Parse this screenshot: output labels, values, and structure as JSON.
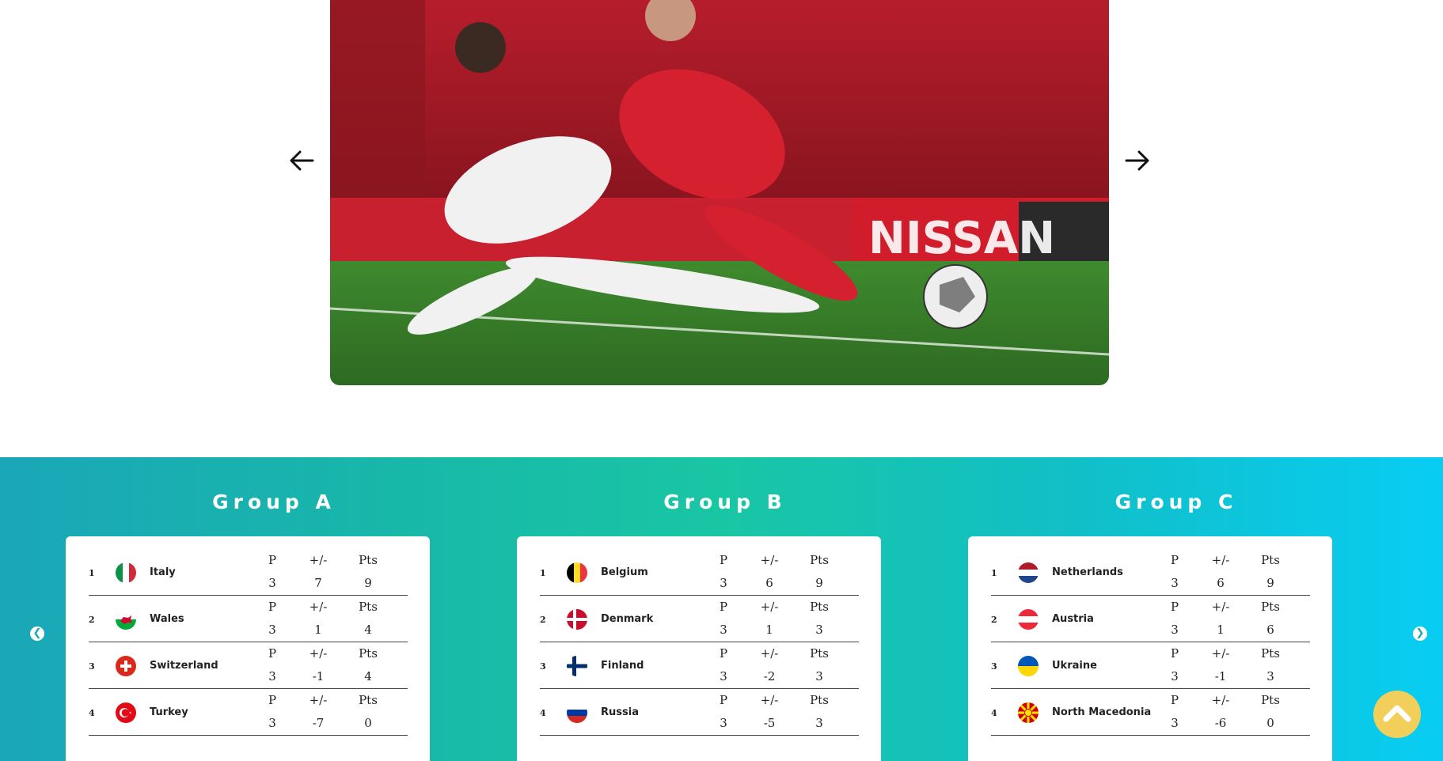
{
  "hero": {
    "prev_icon": "arrow-left-icon",
    "next_icon": "arrow-right-icon",
    "image": "football match action photo"
  },
  "groups": [
    {
      "title": "Group A",
      "teams": [
        {
          "rank": "1",
          "name": "Italy",
          "flag": "italy-flag",
          "p": "3",
          "gd": "7",
          "pts": "9"
        },
        {
          "rank": "2",
          "name": "Wales",
          "flag": "wales-flag",
          "p": "3",
          "gd": "1",
          "pts": "4"
        },
        {
          "rank": "3",
          "name": "Switzerland",
          "flag": "switzerland-flag",
          "p": "3",
          "gd": "-1",
          "pts": "4"
        },
        {
          "rank": "4",
          "name": "Turkey",
          "flag": "turkey-flag",
          "p": "3",
          "gd": "-7",
          "pts": "0"
        }
      ]
    },
    {
      "title": "Group B",
      "teams": [
        {
          "rank": "1",
          "name": "Belgium",
          "flag": "belgium-flag",
          "p": "3",
          "gd": "6",
          "pts": "9"
        },
        {
          "rank": "2",
          "name": "Denmark",
          "flag": "denmark-flag",
          "p": "3",
          "gd": "1",
          "pts": "3"
        },
        {
          "rank": "3",
          "name": "Finland",
          "flag": "finland-flag",
          "p": "3",
          "gd": "-2",
          "pts": "3"
        },
        {
          "rank": "4",
          "name": "Russia",
          "flag": "russia-flag",
          "p": "3",
          "gd": "-5",
          "pts": "3"
        }
      ]
    },
    {
      "title": "Group C",
      "teams": [
        {
          "rank": "1",
          "name": "Netherlands",
          "flag": "netherlands-flag",
          "p": "3",
          "gd": "6",
          "pts": "9"
        },
        {
          "rank": "2",
          "name": "Austria",
          "flag": "austria-flag",
          "p": "3",
          "gd": "1",
          "pts": "6"
        },
        {
          "rank": "3",
          "name": "Ukraine",
          "flag": "ukraine-flag",
          "p": "3",
          "gd": "-1",
          "pts": "3"
        },
        {
          "rank": "4",
          "name": "North Macedonia",
          "flag": "north-macedonia-flag",
          "p": "3",
          "gd": "-6",
          "pts": "0"
        }
      ]
    }
  ],
  "headers": {
    "p": "P",
    "gd": "+/-",
    "pts": "Pts"
  },
  "carousel": {
    "prev_icon": "chevron-left-icon",
    "next_icon": "chevron-right-icon",
    "prev_glyph": "❮",
    "next_glyph": "❯"
  },
  "scroll_top": {
    "icon": "chevron-up-icon",
    "color": "#f2cf5b"
  },
  "colors": {
    "section_start": "#1aa7b8",
    "section_end": "#08cdf3"
  }
}
